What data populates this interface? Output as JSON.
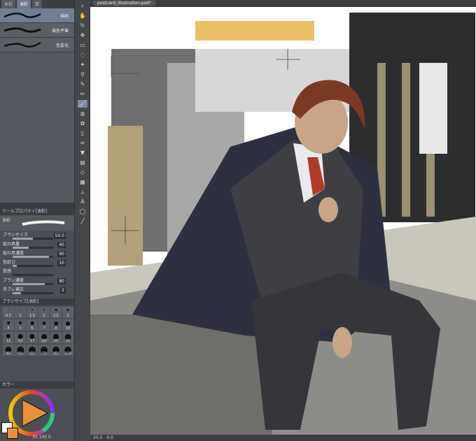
{
  "top_tabs": [
    "水彩",
    "油彩",
    "厚"
  ],
  "brushes": [
    {
      "name": "描画"
    },
    {
      "name": "描色平筆"
    },
    {
      "name": "色変化"
    }
  ],
  "tool_property": {
    "header": "ツールプロパティ[油彩]",
    "brush_label": "油彩",
    "props": [
      {
        "label": "ブラシサイズ",
        "value": "50.0",
        "fraction": 0.5
      },
      {
        "label": "絵の具量",
        "value": "40",
        "fraction": 0.4
      },
      {
        "label": "絵の具濃度",
        "value": "90",
        "fraction": 0.9
      },
      {
        "label": "色延び",
        "value": "10",
        "fraction": 0.1
      },
      {
        "label": "質感",
        "value": "",
        "fraction": 0
      },
      {
        "label": "ブラシ濃度",
        "value": "80",
        "fraction": 0.8
      },
      {
        "label": "手ブレ補正",
        "value": "2",
        "fraction": 0.2
      }
    ]
  },
  "brush_size_panel": {
    "header": "ブラシサイズ[油彩]",
    "sizes": [
      "0.7",
      "1",
      "1.5",
      "2",
      "2.5",
      "3",
      "4",
      "5",
      "6",
      "7",
      "8",
      "10",
      "12",
      "15",
      "17",
      "20",
      "25",
      "30",
      "40",
      "50",
      "60",
      "70",
      "80",
      "100"
    ]
  },
  "color_panel": {
    "header": "カラー",
    "readout": "30 100 0"
  },
  "canvas": {
    "tab_title": "postcard_illustration.psd*"
  },
  "status_bar": {
    "zoom": "25.0",
    "angle": "0.0"
  },
  "tools": [
    "zoom-icon",
    "hand-icon",
    "rotate-icon",
    "move-icon",
    "select-icon",
    "lasso-icon",
    "wand-icon",
    "eyedropper-icon",
    "pen-icon",
    "pencil-icon",
    "brush-icon",
    "airbrush-icon",
    "decoration-icon",
    "eraser-icon",
    "blend-icon",
    "fill-icon",
    "gradient-icon",
    "shape-icon",
    "frame-icon",
    "ruler-icon",
    "text-icon",
    "balloon-icon",
    "correct-line-icon"
  ],
  "colors": {
    "panel": "#4a4e55",
    "selected": "#6e7f96",
    "canvas_bg": "#ffffff",
    "accent_orange": "#e8a24a"
  }
}
